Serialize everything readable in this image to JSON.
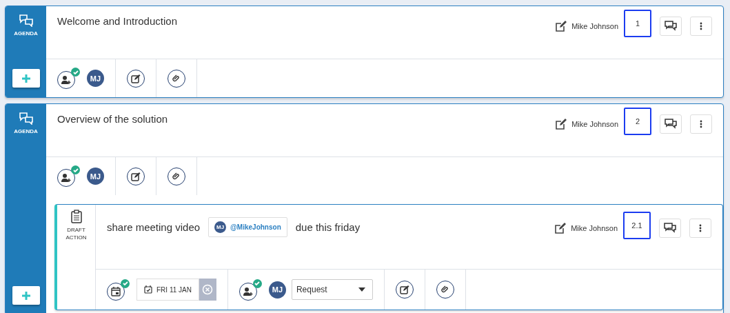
{
  "items": [
    {
      "kind": "agenda",
      "label": "AGENDA",
      "title": "Welcome and Introduction",
      "author": "Mike Johnson",
      "number": "1",
      "number_highlighted": true,
      "assigned": true,
      "initials": "MJ"
    },
    {
      "kind": "agenda",
      "label": "AGENDA",
      "title": "Overview of the solution",
      "author": "Mike Johnson",
      "number": "2",
      "number_highlighted": true,
      "assigned": true,
      "initials": "MJ",
      "actions": [
        {
          "kind": "draft",
          "label": "DRAFT ACTION",
          "text_before": "share meeting video",
          "mention": {
            "initials": "MJ",
            "handle": "@MikeJohnson"
          },
          "text_after": "due this friday",
          "author": "Mike Johnson",
          "number": "2.1",
          "number_highlighted": true,
          "date_set": true,
          "date": "FRI 11 JAN",
          "assigned": true,
          "initials": "MJ",
          "role": "Request"
        }
      ]
    }
  ]
}
